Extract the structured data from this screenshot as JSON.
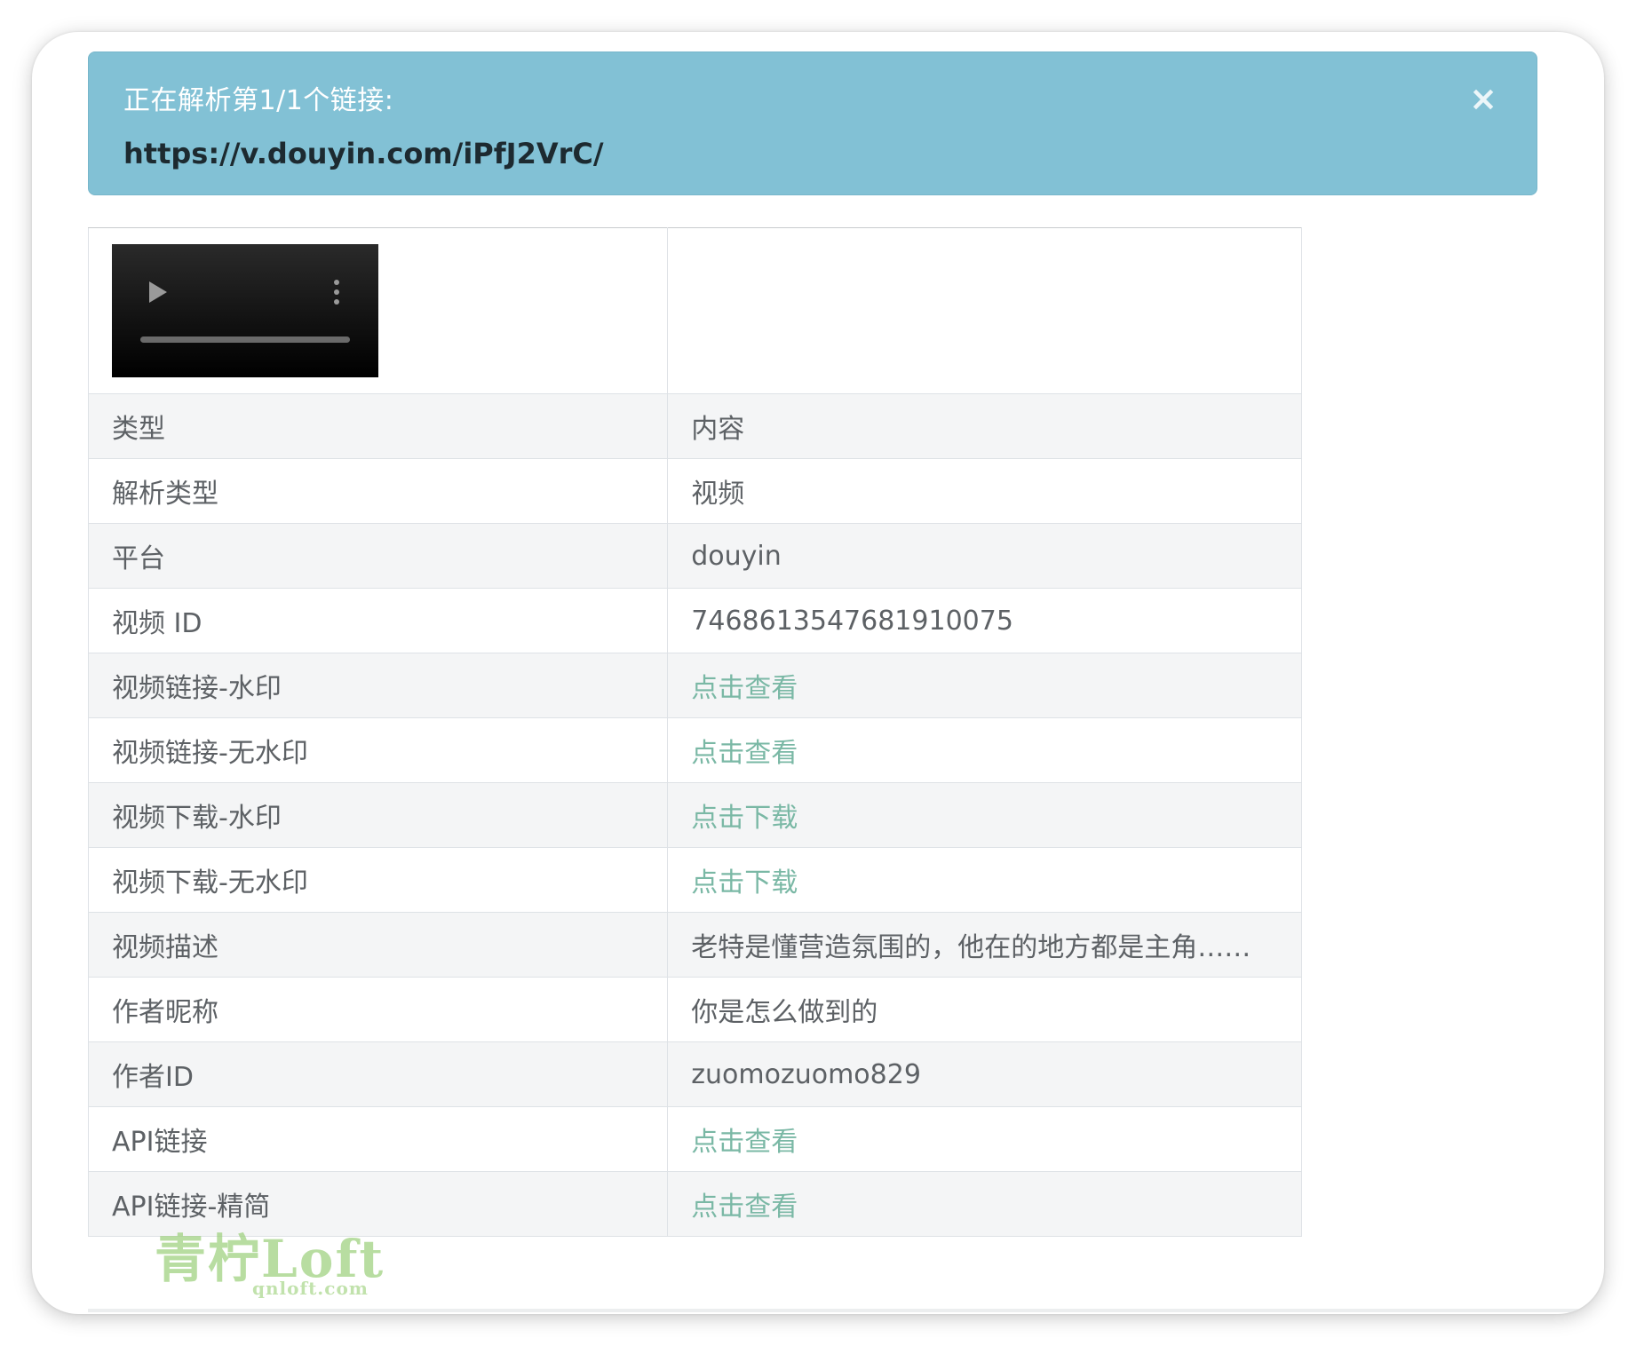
{
  "alert": {
    "title": "正在解析第1/1个链接:",
    "url": "https://v.douyin.com/iPfJ2VrC/",
    "close_glyph": "×"
  },
  "table": {
    "header": {
      "type": "类型",
      "content": "内容"
    },
    "rows": [
      {
        "label": "解析类型",
        "value": "视频",
        "is_link": false
      },
      {
        "label": "平台",
        "value": "douyin",
        "is_link": false
      },
      {
        "label": "视频 ID",
        "value": "7468613547681910075",
        "is_link": false
      },
      {
        "label": "视频链接-水印",
        "value": "点击查看",
        "is_link": true
      },
      {
        "label": "视频链接-无水印",
        "value": "点击查看",
        "is_link": true
      },
      {
        "label": "视频下载-水印",
        "value": "点击下载",
        "is_link": true
      },
      {
        "label": "视频下载-无水印",
        "value": "点击下载",
        "is_link": true
      },
      {
        "label": "视频描述",
        "value": "老特是懂营造氛围的，他在的地方都是主角……",
        "is_link": false
      },
      {
        "label": "作者昵称",
        "value": "你是怎么做到的",
        "is_link": false
      },
      {
        "label": "作者ID",
        "value": "zuomozuomo829",
        "is_link": false
      },
      {
        "label": "API链接",
        "value": "点击查看",
        "is_link": true
      },
      {
        "label": "API链接-精简",
        "value": "点击查看",
        "is_link": true
      }
    ]
  },
  "watermark": {
    "brand": "青柠Loft",
    "domain": "qnloft.com"
  },
  "colors": {
    "alert_bg": "#82c1d5",
    "link": "#7ab8a5",
    "row_alt": "#f4f5f6"
  }
}
